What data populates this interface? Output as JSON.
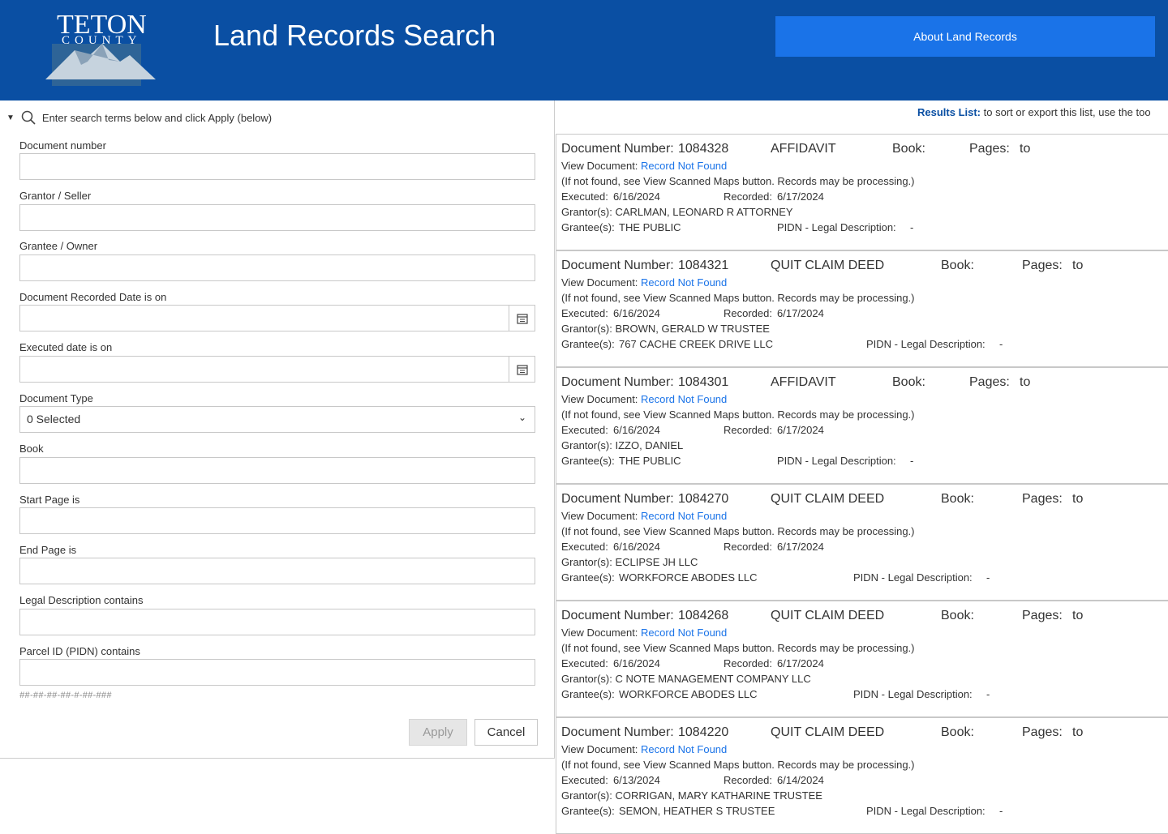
{
  "header": {
    "logo_line1": "TETON",
    "logo_line2": "COUNTY",
    "title": "Land Records Search",
    "about_button": "About Land Records"
  },
  "search": {
    "instructions": "Enter search terms below and click Apply (below)",
    "fields": {
      "document_number": "Document number",
      "grantor": "Grantor / Seller",
      "grantee": "Grantee / Owner",
      "recorded_date": "Document Recorded Date is on",
      "executed_date": "Executed date is on",
      "document_type": "Document Type",
      "document_type_value": "0 Selected",
      "book": "Book",
      "start_page": "Start Page is",
      "end_page": "End Page is",
      "legal_description": "Legal Description contains",
      "parcel_id": "Parcel ID (PIDN) contains",
      "parcel_hint": "##-##-##-##-#-##-###"
    },
    "apply_button": "Apply",
    "cancel_button": "Cancel"
  },
  "results": {
    "header_label": "Results List:",
    "header_text": "to sort or export this list, use the too",
    "labels": {
      "doc_number": "Document Number:",
      "book": "Book:",
      "pages": "Pages:",
      "to": "to",
      "view_document": "View Document:",
      "not_found_note": "(If not found, see View Scanned Maps button. Records may be processing.)",
      "executed": "Executed:",
      "recorded": "Recorded:",
      "grantors": "Grantor(s):",
      "grantees": "Grantee(s):",
      "pidn": "PIDN - Legal Description:",
      "dash": "-"
    },
    "items": [
      {
        "doc_number": "1084328",
        "type": "AFFIDAVIT",
        "view_link": "Record Not Found",
        "executed": "6/16/2024",
        "recorded": "6/17/2024",
        "grantor": "CARLMAN, LEONARD R ATTORNEY",
        "grantee": "THE PUBLIC"
      },
      {
        "doc_number": "1084321",
        "type": "QUIT CLAIM DEED",
        "view_link": "Record Not Found",
        "executed": "6/16/2024",
        "recorded": "6/17/2024",
        "grantor": "BROWN, GERALD W TRUSTEE",
        "grantee": "767 CACHE CREEK DRIVE LLC"
      },
      {
        "doc_number": "1084301",
        "type": "AFFIDAVIT",
        "view_link": "Record Not Found",
        "executed": "6/16/2024",
        "recorded": "6/17/2024",
        "grantor": "IZZO, DANIEL",
        "grantee": "THE PUBLIC"
      },
      {
        "doc_number": "1084270",
        "type": "QUIT CLAIM DEED",
        "view_link": "Record Not Found",
        "executed": "6/16/2024",
        "recorded": "6/17/2024",
        "grantor": "ECLIPSE JH LLC",
        "grantee": "WORKFORCE ABODES LLC"
      },
      {
        "doc_number": "1084268",
        "type": "QUIT CLAIM DEED",
        "view_link": "Record Not Found",
        "executed": "6/16/2024",
        "recorded": "6/17/2024",
        "grantor": "C NOTE MANAGEMENT COMPANY LLC",
        "grantee": "WORKFORCE ABODES LLC"
      },
      {
        "doc_number": "1084220",
        "type": "QUIT CLAIM DEED",
        "view_link": "Record Not Found",
        "executed": "6/13/2024",
        "recorded": "6/14/2024",
        "grantor": "CORRIGAN, MARY KATHARINE TRUSTEE",
        "grantee": "SEMON, HEATHER S TRUSTEE"
      }
    ]
  },
  "colors": {
    "header_bg": "#0a4fa3",
    "button_blue": "#1a73e8",
    "link_blue": "#1a73e8"
  },
  "icons": [
    "search-icon",
    "calendar-icon",
    "chevron-down-icon",
    "caret-down-icon",
    "mountain-logo"
  ]
}
